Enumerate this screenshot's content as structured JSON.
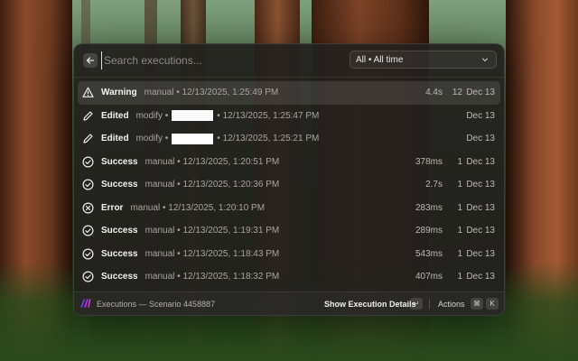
{
  "search": {
    "placeholder": "Search executions..."
  },
  "filter": {
    "value": "All • All time"
  },
  "rows": [
    {
      "status": "Warning",
      "icon": "warning-icon",
      "meta": "manual • 12/13/2025, 1:25:49 PM",
      "duration": "4.4s",
      "count": "12",
      "date": "Dec 13"
    },
    {
      "status": "Edited",
      "icon": "pencil-icon",
      "meta_prefix": "modify •",
      "meta_suffix": "• 12/13/2025, 1:25:47 PM",
      "duration": "",
      "count": "",
      "date": "Dec 13"
    },
    {
      "status": "Edited",
      "icon": "pencil-icon",
      "meta_prefix": "modify •",
      "meta_suffix": "• 12/13/2025, 1:25:21 PM",
      "duration": "",
      "count": "",
      "date": "Dec 13"
    },
    {
      "status": "Success",
      "icon": "check-circle-icon",
      "meta": "manual • 12/13/2025, 1:20:51 PM",
      "duration": "378ms",
      "count": "1",
      "date": "Dec 13"
    },
    {
      "status": "Success",
      "icon": "check-circle-icon",
      "meta": "manual • 12/13/2025, 1:20:36 PM",
      "duration": "2.7s",
      "count": "1",
      "date": "Dec 13"
    },
    {
      "status": "Error",
      "icon": "x-circle-icon",
      "meta": "manual • 12/13/2025, 1:20:10 PM",
      "duration": "283ms",
      "count": "1",
      "date": "Dec 13"
    },
    {
      "status": "Success",
      "icon": "check-circle-icon",
      "meta": "manual • 12/13/2025, 1:19:31 PM",
      "duration": "289ms",
      "count": "1",
      "date": "Dec 13"
    },
    {
      "status": "Success",
      "icon": "check-circle-icon",
      "meta": "manual • 12/13/2025, 1:18:43 PM",
      "duration": "543ms",
      "count": "1",
      "date": "Dec 13"
    },
    {
      "status": "Success",
      "icon": "check-circle-icon",
      "meta": "manual • 12/13/2025, 1:18:32 PM",
      "duration": "407ms",
      "count": "1",
      "date": "Dec 13"
    }
  ],
  "footer": {
    "title": "Executions — Scenario 4458887",
    "primary_action": "Show Execution Details",
    "enter_key": "↵",
    "actions_label": "Actions",
    "cmd_key": "⌘",
    "k_key": "K"
  },
  "colors": {
    "brand": "#a64dff",
    "panel": "#22201e"
  }
}
